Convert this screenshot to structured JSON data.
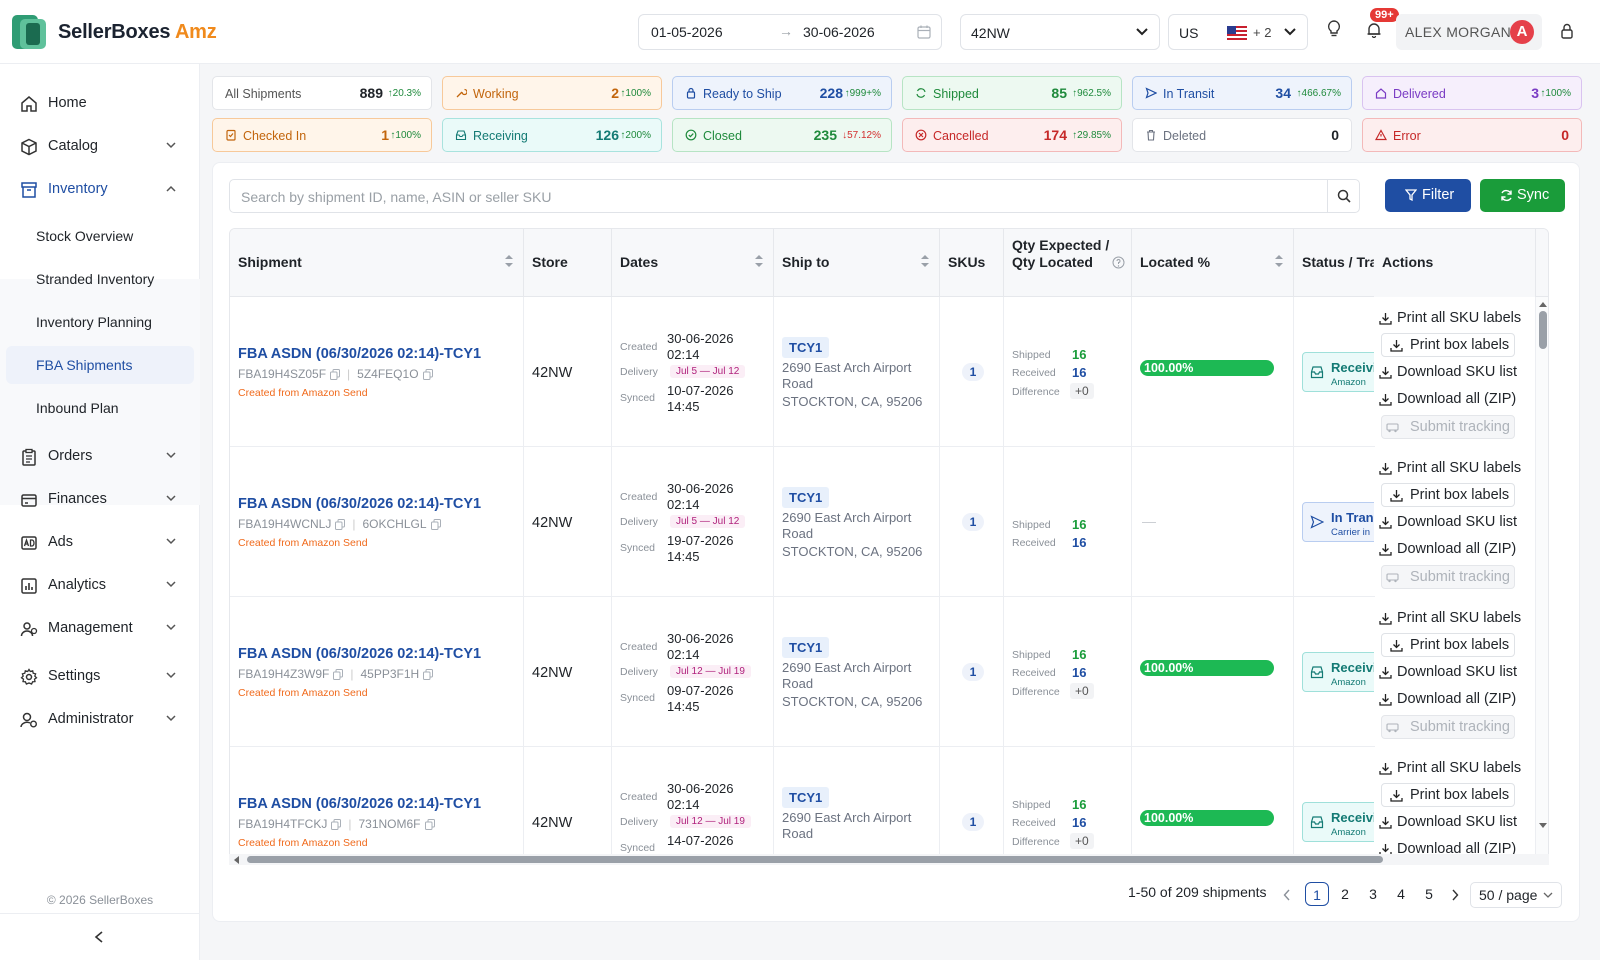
{
  "app": {
    "brand": "SellerBoxes",
    "brand_suffix": "Amz",
    "copyright": "© 2026 SellerBoxes"
  },
  "topbar": {
    "date_from": "01-05-2026",
    "date_to": "30-06-2026",
    "store": "42NW",
    "marketplace": "US",
    "extra_markets": "+ 2",
    "notification_count": "99+",
    "user_name": "ALEX MORGAN",
    "user_initial": "A"
  },
  "sidebar": {
    "items": [
      {
        "label": "Home",
        "icon": "home-icon"
      },
      {
        "label": "Catalog",
        "icon": "box-icon"
      },
      {
        "label": "Inventory",
        "icon": "archive-icon"
      },
      {
        "label": "Orders",
        "icon": "clipboard-icon"
      },
      {
        "label": "Finances",
        "icon": "wallet-icon"
      },
      {
        "label": "Ads",
        "icon": "ad-icon"
      },
      {
        "label": "Analytics",
        "icon": "chart-icon"
      },
      {
        "label": "Management",
        "icon": "users-icon"
      },
      {
        "label": "Settings",
        "icon": "gear-icon"
      },
      {
        "label": "Administrator",
        "icon": "admin-icon"
      }
    ],
    "inventory_sub": [
      "Stock Overview",
      "Stranded Inventory",
      "Inventory Planning",
      "FBA Shipments",
      "Inbound Plan"
    ]
  },
  "status_cards": [
    {
      "label": "All Shipments",
      "count": "889",
      "pct": "20.3%",
      "dir": "up"
    },
    {
      "label": "Working",
      "count": "2",
      "pct": "100%",
      "dir": "up"
    },
    {
      "label": "Ready to Ship",
      "count": "228",
      "pct": "999+%",
      "dir": "up"
    },
    {
      "label": "Shipped",
      "count": "85",
      "pct": "962.5%",
      "dir": "up"
    },
    {
      "label": "In Transit",
      "count": "34",
      "pct": "466.67%",
      "dir": "up"
    },
    {
      "label": "Delivered",
      "count": "3",
      "pct": "100%",
      "dir": "up"
    },
    {
      "label": "Checked In",
      "count": "1",
      "pct": "100%",
      "dir": "up"
    },
    {
      "label": "Receiving",
      "count": "126",
      "pct": "200%",
      "dir": "up"
    },
    {
      "label": "Closed",
      "count": "235",
      "pct": "57.12%",
      "dir": "down"
    },
    {
      "label": "Cancelled",
      "count": "174",
      "pct": "29.85%",
      "dir": "up"
    },
    {
      "label": "Deleted",
      "count": "0",
      "pct": "",
      "dir": ""
    },
    {
      "label": "Error",
      "count": "0",
      "pct": "",
      "dir": ""
    }
  ],
  "search": {
    "placeholder": "Search by shipment ID, name, ASIN or seller SKU"
  },
  "buttons": {
    "filter": "Filter",
    "sync": "Sync"
  },
  "table": {
    "columns": [
      "Shipment",
      "Store",
      "Dates",
      "Ship to",
      "SKUs",
      "Qty Expected /",
      "Qty Located",
      "Located %",
      "Status / Tracking",
      "Actions"
    ],
    "date_labels": {
      "created": "Created",
      "delivery": "Delivery",
      "synced": "Synced"
    },
    "qty_labels": {
      "shipped": "Shipped",
      "received": "Received",
      "difference": "Difference"
    },
    "actions": [
      "Print all SKU labels",
      "Print box labels",
      "Download SKU list",
      "Download all (ZIP)",
      "Submit tracking"
    ],
    "rows": [
      {
        "name": "FBA ASDN (06/30/2026 02:14)-TCY1",
        "id": "FBA19H4SZ05F",
        "ref": "5Z4FEQ1O",
        "source": "Created from Amazon Send",
        "store": "42NW",
        "created_date": "30-06-2026",
        "created_time": "02:14",
        "delivery": "Jul 5 — Jul 12",
        "synced_date": "10-07-2026",
        "synced_time": "14:45",
        "ship_code": "TCY1",
        "addr1": "2690 East Arch Airport Road",
        "addr2": "STOCKTON, CA, 95206",
        "skus": "1",
        "shipped": "16",
        "received": "16",
        "difference": "+0",
        "located": "100.00%",
        "located_frac": 1.0,
        "status": "Receiving",
        "status_sub": "Amazon"
      },
      {
        "name": "FBA ASDN (06/30/2026 02:14)-TCY1",
        "id": "FBA19H4WCNLJ",
        "ref": "6OKCHLGL",
        "source": "Created from Amazon Send",
        "store": "42NW",
        "created_date": "30-06-2026",
        "created_time": "02:14",
        "delivery": "Jul 5 — Jul 12",
        "synced_date": "19-07-2026",
        "synced_time": "14:45",
        "ship_code": "TCY1",
        "addr1": "2690 East Arch Airport Road",
        "addr2": "STOCKTON, CA, 95206",
        "skus": "1",
        "shipped": "16",
        "received": "16",
        "difference": "",
        "located": "—",
        "located_frac": null,
        "status": "In Transit",
        "status_sub": "Carrier in"
      },
      {
        "name": "FBA ASDN (06/30/2026 02:14)-TCY1",
        "id": "FBA19H4Z3W9F",
        "ref": "45PP3F1H",
        "source": "Created from Amazon Send",
        "store": "42NW",
        "created_date": "30-06-2026",
        "created_time": "02:14",
        "delivery": "Jul 12 — Jul 19",
        "synced_date": "09-07-2026",
        "synced_time": "14:45",
        "ship_code": "TCY1",
        "addr1": "2690 East Arch Airport Road",
        "addr2": "STOCKTON, CA, 95206",
        "skus": "1",
        "shipped": "16",
        "received": "16",
        "difference": "+0",
        "located": "100.00%",
        "located_frac": 1.0,
        "status": "Receiving",
        "status_sub": "Amazon"
      },
      {
        "name": "FBA ASDN (06/30/2026 02:14)-TCY1",
        "id": "FBA19H4TFCKJ",
        "ref": "731NOM6F",
        "source": "Created from Amazon Send",
        "store": "42NW",
        "created_date": "30-06-2026",
        "created_time": "02:14",
        "delivery": "Jul 12 — Jul 19",
        "synced_date": "14-07-2026",
        "synced_time": "",
        "ship_code": "TCY1",
        "addr1": "2690 East Arch Airport Road",
        "addr2": "",
        "skus": "1",
        "shipped": "16",
        "received": "16",
        "difference": "+0",
        "located": "100.00%",
        "located_frac": 1.0,
        "status": "Receiving",
        "status_sub": "Amazon"
      }
    ]
  },
  "pagination": {
    "summary": "1-50 of 209 shipments",
    "pages": [
      "1",
      "2",
      "3",
      "4",
      "5"
    ],
    "current": "1",
    "page_size": "50 / page"
  }
}
